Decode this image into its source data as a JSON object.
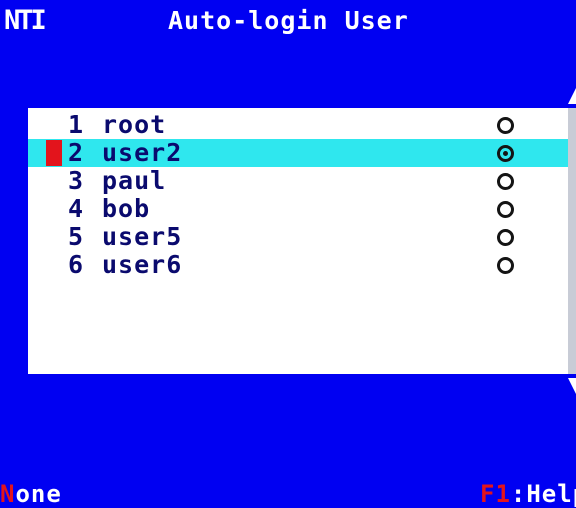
{
  "header": {
    "logo": "NTI",
    "title": "Auto-login User"
  },
  "users": [
    {
      "number": "1",
      "name": "root",
      "selected": false,
      "checked": false
    },
    {
      "number": "2",
      "name": "user2",
      "selected": true,
      "checked": true
    },
    {
      "number": "3",
      "name": "paul",
      "selected": false,
      "checked": false
    },
    {
      "number": "4",
      "name": "bob",
      "selected": false,
      "checked": false
    },
    {
      "number": "5",
      "name": "user5",
      "selected": false,
      "checked": false
    },
    {
      "number": "6",
      "name": "user6",
      "selected": false,
      "checked": false
    }
  ],
  "status": {
    "left_hotkey": "N",
    "left_rest": "one",
    "right_hotkey": "F1",
    "right_rest": ":Help"
  },
  "colors": {
    "background": "#0000f2",
    "highlight_row": "#2fe7ee",
    "hotkey": "#e3141c",
    "item_text": "#0a0a6e"
  }
}
